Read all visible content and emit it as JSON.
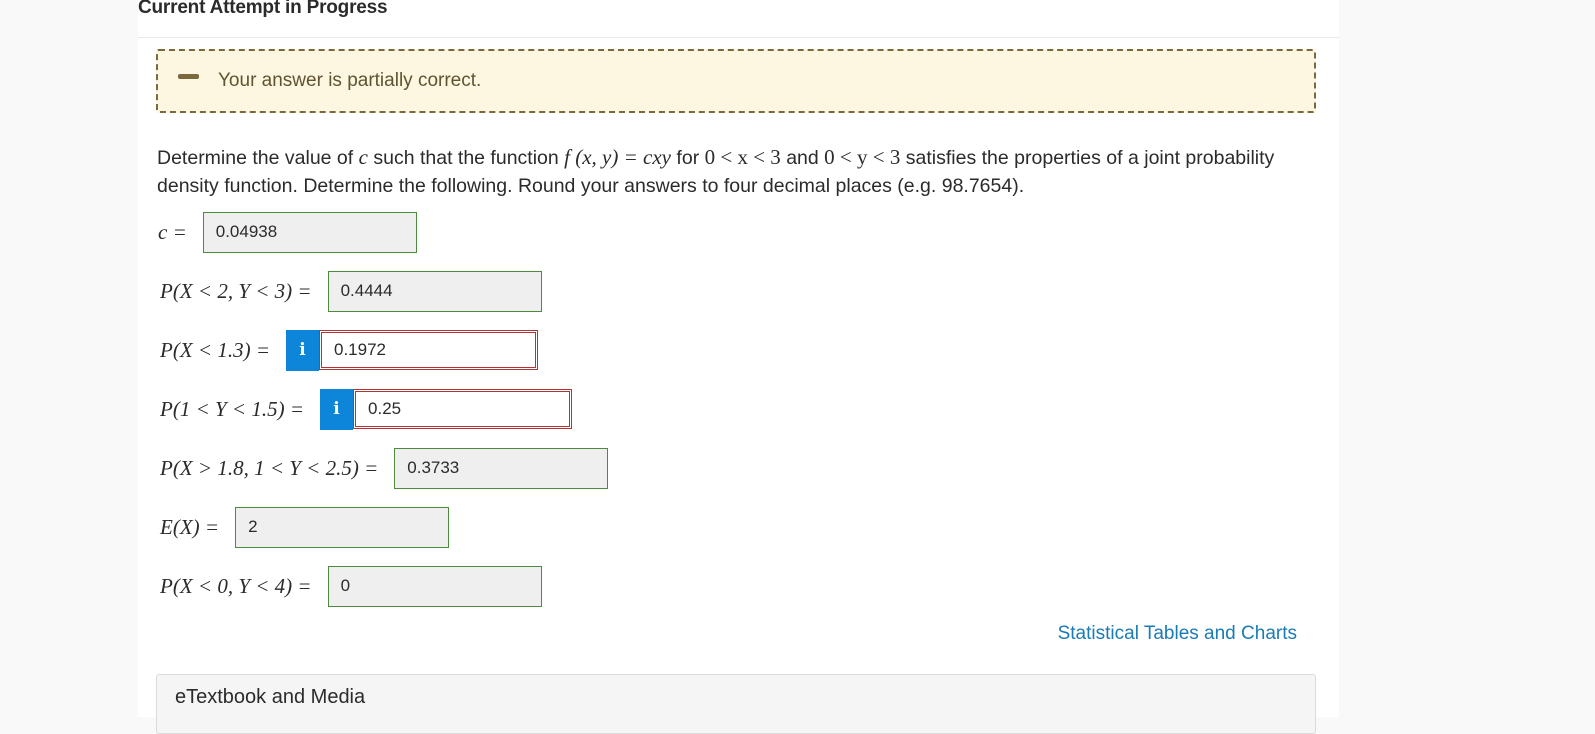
{
  "header": {
    "title": "Current Attempt in Progress"
  },
  "feedback": {
    "message": "Your answer is partially correct."
  },
  "question": {
    "text_1": "Determine the value of ",
    "var_c": "c",
    "text_2": " such that the function ",
    "func": "f (x, y) = cxy",
    "text_3": " for ",
    "cond_x": "0 < x < 3",
    "text_4": " and ",
    "cond_y": "0 < y < 3",
    "text_5": " satisfies the properties of a joint probability density function. Determine the following. Round your answers to four decimal places (e.g. 98.7654)."
  },
  "answers": [
    {
      "label": "c =",
      "value": "0.04938",
      "status": "correct"
    },
    {
      "label": "P(X < 2, Y < 3) =",
      "value": "0.4444",
      "status": "correct"
    },
    {
      "label": "P(X < 1.3) =",
      "value": "0.1972",
      "status": "incorrect",
      "info_icon": "i"
    },
    {
      "label": "P(1 < Y < 1.5) =",
      "value": "0.25",
      "status": "incorrect",
      "info_icon": "i"
    },
    {
      "label": "P(X > 1.8, 1 < Y < 2.5) =",
      "value": "0.3733",
      "status": "correct"
    },
    {
      "label": "E(X) =",
      "value": "2",
      "status": "correct"
    },
    {
      "label": "P(X < 0, Y < 4) =",
      "value": "0",
      "status": "correct"
    }
  ],
  "links": {
    "statistical_tables": "Statistical Tables and Charts"
  },
  "etextbook": {
    "label": "eTextbook and Media"
  },
  "colors": {
    "correct_border": "#4e8a3d",
    "incorrect_border": "#b23434",
    "info_button": "#0d85d8",
    "feedback_bg": "#fdf6e0",
    "link": "#1b7bb5"
  }
}
